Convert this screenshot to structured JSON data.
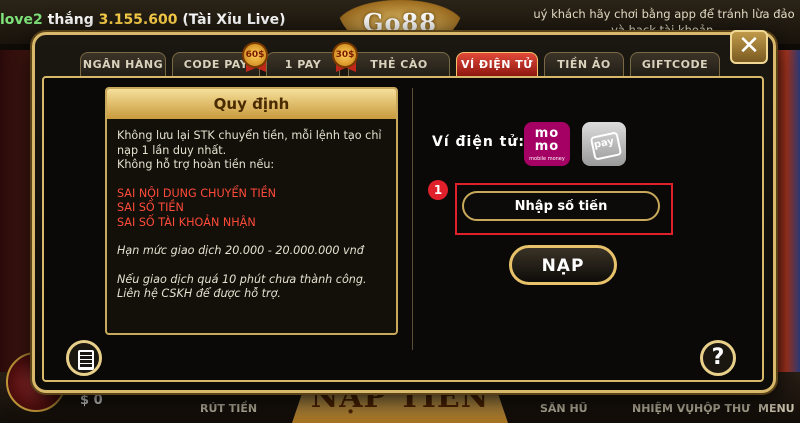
{
  "background": {
    "ticker": {
      "user": "love2",
      "verb": "thắng",
      "amount": "3.155.600",
      "game": "(Tài Xỉu Live)"
    },
    "notice": "uý khách hãy chơi bằng app để tránh lừa đảo và hack tài khoản.",
    "logo_text": "Go88",
    "balance": "$ 0",
    "nav": {
      "rut_tien": "RÚT TIỀN",
      "nap_tien": "NẠP TIỀN",
      "san_hu": "SĂN HŨ",
      "nhiem_vu": "NHIỆM VỤ",
      "hop_thu": "HỘP THƯ",
      "menu": "MENU"
    }
  },
  "dialog": {
    "close_symbol": "✕",
    "tabs": [
      {
        "label": "NGÂN HÀNG",
        "active": false
      },
      {
        "label": "CODE PAY",
        "active": false,
        "badge": "60$"
      },
      {
        "label": "1 PAY",
        "active": false,
        "badge": "30$"
      },
      {
        "label": "THẺ CÀO",
        "active": false
      },
      {
        "label": "VÍ ĐIỆN TỬ",
        "active": true
      },
      {
        "label": "TIỀN ẢO",
        "active": false
      },
      {
        "label": "GIFTCODE",
        "active": false
      }
    ],
    "rules": {
      "title": "Quy định",
      "line1": "Không lưu lại STK chuyển tiền, mỗi lệnh tạo chỉ nạp 1 lần duy nhất.",
      "line2": "Không hỗ trợ hoàn tiền nếu:",
      "warn1": "SAI NỘI DUNG CHUYỂN TIỀN",
      "warn2": "SAI SỐ TIỀN",
      "warn3": "SAI SỐ TÀI KHOẢN NHẬN",
      "limit": "Hạn mức giao dịch 20.000 - 20.000.000 vnđ",
      "support": "Nếu giao dịch quá 10 phút chưa thành công. Liên hệ CSKH để được hỗ trợ."
    },
    "wallet": {
      "label": "Ví điện tử:",
      "momo_line1": "mo",
      "momo_line2": "mo",
      "momo_sub": "mobile money",
      "zalopay_text": "pay"
    },
    "step_number": "1",
    "amount_placeholder": "Nhập số tiền",
    "submit_label": "NẠP",
    "help_symbol": "?"
  }
}
